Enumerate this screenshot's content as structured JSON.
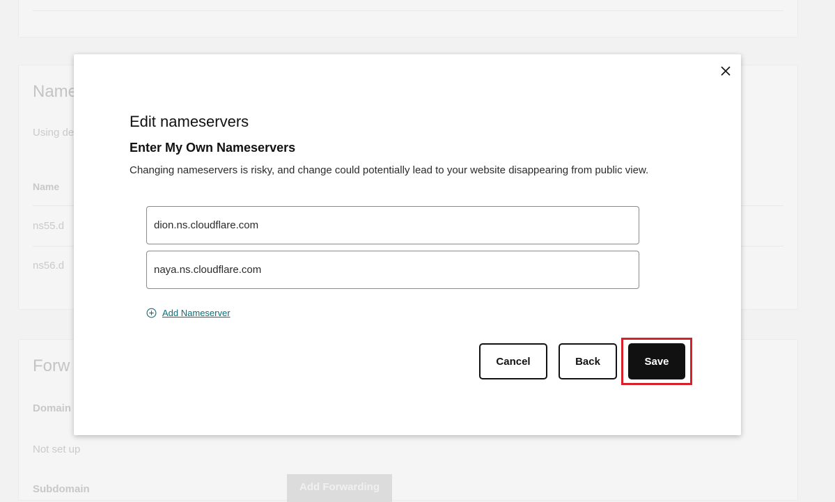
{
  "background": {
    "nameservers_title": "Name",
    "nameservers_desc": "Using de",
    "col_header": "Name",
    "row1": "ns55.d",
    "row2": "ns56.d",
    "forwarding_title": "Forw",
    "domain_label": "Domain",
    "not_set_up": "Not set up",
    "subdomain_label": "Subdomain",
    "add_forwarding_button": "Add Forwarding"
  },
  "modal": {
    "close_icon": "close-icon",
    "title": "Edit nameservers",
    "subtitle": "Enter My Own Nameservers",
    "description": "Changing nameservers is risky, and change could potentially lead to your website disappearing from public view.",
    "nameservers": [
      "dion.ns.cloudflare.com",
      "naya.ns.cloudflare.com"
    ],
    "add_nameserver_icon": "plus-circle-icon",
    "add_nameserver_label": "Add Nameserver",
    "cancel_label": "Cancel",
    "back_label": "Back",
    "save_label": "Save",
    "highlight_color": "#d8202a"
  }
}
